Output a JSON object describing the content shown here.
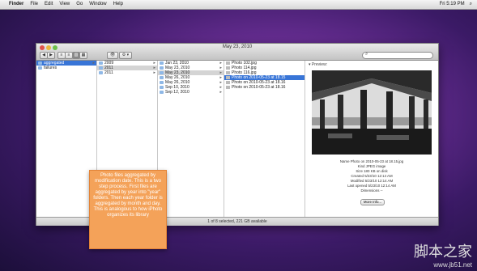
{
  "menubar": {
    "apple_icon": "apple-icon",
    "items": [
      "Finder",
      "File",
      "Edit",
      "View",
      "Go",
      "Window",
      "Help"
    ],
    "right": [
      "Fri 5:19 PM"
    ]
  },
  "window": {
    "title": "May 23, 2010",
    "toolbar": {
      "back": "◀",
      "forward": "▶",
      "view_buttons": [
        "≡",
        "≡",
        "▥",
        "▦"
      ],
      "eye": "👁",
      "gear": "⚙ ▾"
    },
    "columns": {
      "col1": [
        {
          "label": "aggregated",
          "selected": true
        },
        {
          "label": "failures",
          "selected": false
        }
      ],
      "col2": [
        {
          "label": "2009",
          "state": "normal"
        },
        {
          "label": "2011",
          "state": "hl"
        },
        {
          "label": "2011",
          "state": "normal"
        }
      ],
      "col3": [
        {
          "label": "Jan 23, 2010",
          "state": "normal"
        },
        {
          "label": "May 23, 2010",
          "state": "hl"
        },
        {
          "label": "May 23, 2010",
          "state": "normal"
        },
        {
          "label": "May 26, 2010",
          "state": "normal"
        },
        {
          "label": "May 26, 2010",
          "state": "normal"
        },
        {
          "label": "Sep 10, 2010",
          "state": "normal"
        },
        {
          "label": "Sep 12, 2010",
          "state": "normal"
        }
      ],
      "col4": [
        {
          "label": "Photo 102.jpg",
          "state": "normal"
        },
        {
          "label": "Photo 114.jpg",
          "state": "normal"
        },
        {
          "label": "Photo 116.jpg",
          "state": "normal"
        },
        {
          "label": "Photo on 2010-05-23 at 18.15",
          "state": "sel"
        },
        {
          "label": "Photo on 2010-05-23 at 18.16",
          "state": "normal"
        },
        {
          "label": "Photo on 2010-05-23 at 18.16",
          "state": "normal"
        }
      ]
    },
    "preview": {
      "heading": "▾ Preview:",
      "meta": [
        "Name Photo on 2010-05-23 at 18.15.jpg",
        "Kind JPEG image",
        "Size 180 KB on disk",
        "Created 5/23/10 12:14 AM",
        "Modified 5/23/10 12:14 AM",
        "Last opened 5/23/10 12:14 AM",
        "Dimensions --"
      ],
      "more_info": "More Info..."
    },
    "status": "1 of 8 selected, 221 GB available"
  },
  "callout": "Photo files aggregated by modification date. This is a two step process. First files are aggregated by year into \"year\" folders. Then each year folder is aggregated by month and day. This is analogous to how iPhoto organizes its library",
  "watermark": {
    "cn": "脚本之家",
    "url": "www.jb51.net"
  },
  "colors": {
    "selection": "#3875d7",
    "callout": "#f4a259"
  }
}
